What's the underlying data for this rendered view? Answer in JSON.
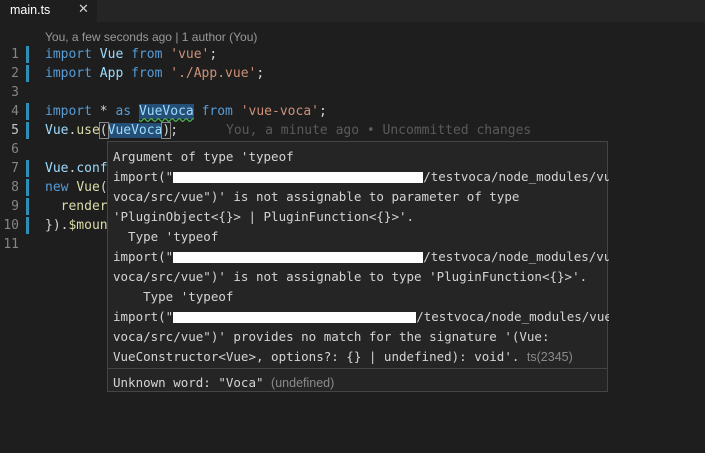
{
  "tab": {
    "title": "main.ts",
    "close_glyph": "✕"
  },
  "codelens": "You, a few seconds ago | 1 author (You)",
  "lines": [
    {
      "n": "1",
      "parts": [
        [
          "kw",
          "import"
        ],
        [
          "punc",
          " "
        ],
        [
          "id",
          "Vue"
        ],
        [
          "punc",
          " "
        ],
        [
          "kw",
          "from"
        ],
        [
          "punc",
          " "
        ],
        [
          "str",
          "'vue'"
        ],
        [
          "punc",
          ";"
        ]
      ]
    },
    {
      "n": "2",
      "parts": [
        [
          "kw",
          "import"
        ],
        [
          "punc",
          " "
        ],
        [
          "id",
          "App"
        ],
        [
          "punc",
          " "
        ],
        [
          "kw",
          "from"
        ],
        [
          "punc",
          " "
        ],
        [
          "str",
          "'./App.vue'"
        ],
        [
          "punc",
          ";"
        ]
      ]
    },
    {
      "n": "3",
      "parts": []
    },
    {
      "n": "4",
      "parts": [
        [
          "kw",
          "import"
        ],
        [
          "punc",
          " * "
        ],
        [
          "kw",
          "as"
        ],
        [
          "punc",
          " "
        ],
        [
          "id hl squiggle",
          "VueVoca"
        ],
        [
          "punc",
          " "
        ],
        [
          "kw",
          "from"
        ],
        [
          "punc",
          " "
        ],
        [
          "str",
          "'vue-voca'"
        ],
        [
          "punc",
          ";"
        ]
      ]
    },
    {
      "n": "5",
      "parts": [
        [
          "id",
          "Vue"
        ],
        [
          "punc",
          "."
        ],
        [
          "fn",
          "use"
        ],
        [
          "punc bracket",
          "("
        ],
        [
          "id hl",
          "VueVoca"
        ],
        [
          "punc bracket",
          ")"
        ],
        [
          "punc",
          ";"
        ]
      ]
    },
    {
      "n": "6",
      "parts": []
    },
    {
      "n": "7",
      "parts": [
        [
          "id",
          "Vue"
        ],
        [
          "punc",
          "."
        ],
        [
          "id",
          "conf"
        ]
      ]
    },
    {
      "n": "8",
      "parts": [
        [
          "kw",
          "new"
        ],
        [
          "punc",
          " "
        ],
        [
          "fn",
          "Vue"
        ],
        [
          "punc",
          "("
        ]
      ]
    },
    {
      "n": "9",
      "parts": [
        [
          "punc",
          "  "
        ],
        [
          "fn",
          "render"
        ]
      ]
    },
    {
      "n": "10",
      "parts": [
        [
          "punc",
          "})."
        ],
        [
          "fn",
          "$moun"
        ]
      ]
    },
    {
      "n": "11",
      "parts": []
    }
  ],
  "blame_line5": "You, a minute ago • Uncommitted changes",
  "hover": {
    "rows": [
      "Argument of type 'typeof",
      "import(\"",
      "voca/src/vue\")' is not assignable to parameter of type",
      "'PluginObject<{}> | PluginFunction<{}>'.",
      "  Type 'typeof",
      "import(\"",
      "voca/src/vue\")' is not assignable to type 'PluginFunction<{}>'.",
      "    Type 'typeof",
      "import(\"",
      "voca/src/vue\")' provides no match for the signature '(Vue:",
      "VueConstructor<Vue>, options?: {} | undefined): void'."
    ],
    "path_tail": "/testvoca/node_modules/vue-",
    "ts_code": "ts(2345)",
    "footer_msg": "Unknown word: \"Voca\"",
    "footer_src": "(undefined)"
  }
}
